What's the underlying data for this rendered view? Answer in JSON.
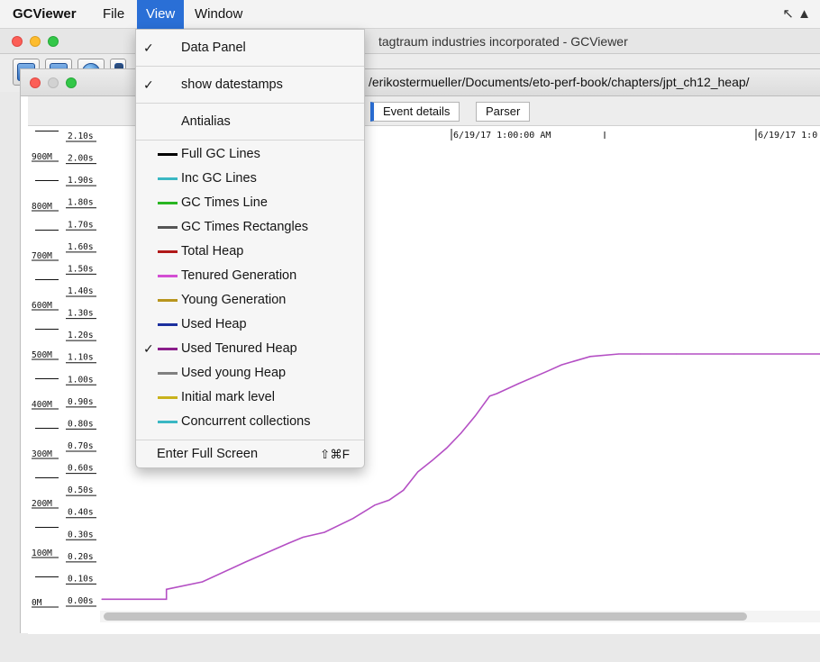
{
  "menubar": {
    "app_name": "GCViewer",
    "file": "File",
    "view": "View",
    "window": "Window"
  },
  "main_window": {
    "title": "tagtraum industries incorporated - GCViewer"
  },
  "doc_window": {
    "path": "/erikostermueller/Documents/eto-perf-book/chapters/jpt_ch12_heap/"
  },
  "tabs": {
    "event_details": "Event details",
    "parser": "Parser"
  },
  "view_menu": {
    "data_panel": "Data Panel",
    "show_datestamps": "show datestamps",
    "antialias": "Antialias",
    "check_mark": "✓",
    "legend_items": [
      {
        "label": "Full GC Lines",
        "color": "#000000",
        "checked": false
      },
      {
        "label": "Inc GC Lines",
        "color": "#3ab7c3",
        "checked": false
      },
      {
        "label": "GC Times Line",
        "color": "#29b622",
        "checked": false
      },
      {
        "label": "GC Times Rectangles",
        "color": "#555555",
        "checked": false
      },
      {
        "label": "Total Heap",
        "color": "#b01818",
        "checked": false
      },
      {
        "label": "Tenured Generation",
        "color": "#d34ed3",
        "checked": false
      },
      {
        "label": "Young Generation",
        "color": "#b8951d",
        "checked": false
      },
      {
        "label": "Used Heap",
        "color": "#1b2f9e",
        "checked": false
      },
      {
        "label": "Used Tenured Heap",
        "color": "#8a1d8a",
        "checked": true
      },
      {
        "label": "Used young Heap",
        "color": "#808080",
        "checked": false
      },
      {
        "label": "Initial mark level",
        "color": "#c9b21c",
        "checked": false
      },
      {
        "label": "Concurrent collections",
        "color": "#3ab7c3",
        "checked": false
      }
    ],
    "enter_full_screen": "Enter Full Screen",
    "full_screen_shortcut": "⇧⌘F"
  },
  "chart": {
    "memory_ticks": [
      "900M",
      "800M",
      "700M",
      "600M",
      "500M",
      "400M",
      "300M",
      "200M",
      "100M",
      "0M"
    ],
    "pause_ticks": [
      "2.10s",
      "2.00s",
      "1.90s",
      "1.80s",
      "1.70s",
      "1.60s",
      "1.50s",
      "1.40s",
      "1.30s",
      "1.20s",
      "1.10s",
      "1.00s",
      "0.90s",
      "0.80s",
      "0.70s",
      "0.60s",
      "0.50s",
      "0.40s",
      "0.30s",
      "0.20s",
      "0.10s",
      "0.00s"
    ],
    "date_labels": [
      "6/19/17 1:00:00 AM",
      "6/19/17 1:0"
    ],
    "line_color": "#b44fc4"
  },
  "chart_data": {
    "type": "line",
    "title": "",
    "ylabel": "",
    "xlabel": "",
    "ylim": [
      0,
      950
    ],
    "series": [
      {
        "name": "Used Tenured Heap",
        "x": [
          0,
          9,
          9,
          14,
          20,
          26,
          28,
          31,
          35,
          38,
          40,
          42,
          44,
          46,
          48,
          50,
          52,
          54,
          55,
          58,
          62,
          64,
          68,
          72,
          75,
          80,
          88,
          100
        ],
        "values": [
          5,
          5,
          25,
          40,
          80,
          118,
          130,
          140,
          168,
          195,
          205,
          225,
          262,
          285,
          310,
          340,
          375,
          415,
          420,
          440,
          465,
          478,
          495,
          500,
          500,
          500,
          500,
          500
        ]
      }
    ]
  }
}
